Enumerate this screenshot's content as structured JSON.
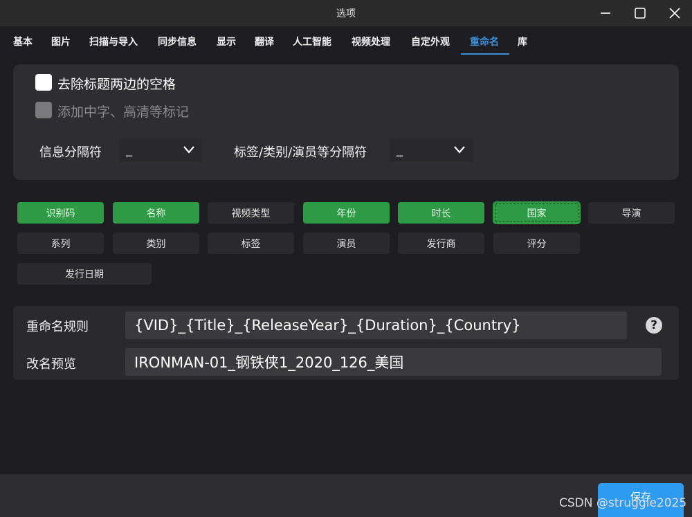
{
  "window": {
    "title": "选项"
  },
  "tabs": [
    {
      "label": "基本"
    },
    {
      "label": "图片"
    },
    {
      "label": "扫描与导入"
    },
    {
      "label": "同步信息"
    },
    {
      "label": "显示"
    },
    {
      "label": "翻译"
    },
    {
      "label": "人工智能"
    },
    {
      "label": "视频处理"
    },
    {
      "label": "自定外观"
    },
    {
      "label": "重命名"
    },
    {
      "label": "库"
    }
  ],
  "active_tab": "重命名",
  "options": {
    "trim_title_spaces": {
      "label": "去除标题两边的空格",
      "checked": false
    },
    "add_tags": {
      "label": "添加中字、高清等标记",
      "checked": false,
      "disabled": true
    },
    "info_separator": {
      "label": "信息分隔符",
      "value": "_"
    },
    "list_separator": {
      "label": "标签/类别/演员等分隔符",
      "value": "_"
    }
  },
  "fields": [
    {
      "label": "识别码",
      "selected": true
    },
    {
      "label": "名称",
      "selected": true
    },
    {
      "label": "视频类型",
      "selected": false
    },
    {
      "label": "年份",
      "selected": true
    },
    {
      "label": "时长",
      "selected": true
    },
    {
      "label": "国家",
      "selected": true
    },
    {
      "label": "导演",
      "selected": false
    },
    {
      "label": "系列",
      "selected": false
    },
    {
      "label": "类别",
      "selected": false
    },
    {
      "label": "标签",
      "selected": false
    },
    {
      "label": "演员",
      "selected": false
    },
    {
      "label": "发行商",
      "selected": false
    },
    {
      "label": "评分",
      "selected": false
    },
    {
      "label": "发行日期",
      "selected": false
    }
  ],
  "rename": {
    "rule_label": "重命名规则",
    "rule_value": "{VID}_{Title}_{ReleaseYear}_{Duration}_{Country}",
    "preview_label": "改名预览",
    "preview_value": "IRONMAN-01_钢铁侠1_2020_126_美国",
    "help_symbol": "?"
  },
  "footer": {
    "save_label": "保存"
  },
  "watermark": "CSDN @struggle2025",
  "colors": {
    "accent": "#3a8fd8",
    "selected_tag": "#2f9a46",
    "save_button": "#2d9bf0"
  }
}
